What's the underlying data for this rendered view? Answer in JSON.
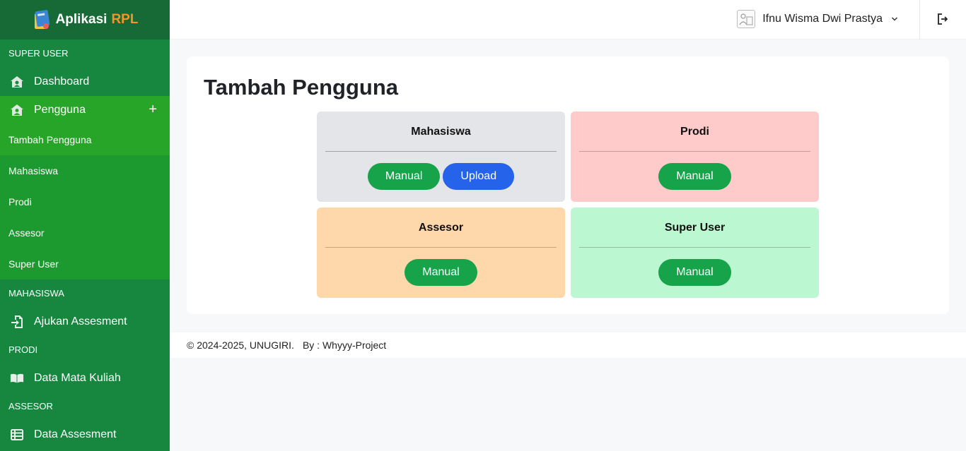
{
  "brand": {
    "name": "Aplikasi",
    "accent": "RPL",
    "accent_color": "#f59526"
  },
  "sidebar": {
    "sections": [
      {
        "title": "SUPER USER"
      },
      {
        "title": "MAHASISWA"
      },
      {
        "title": "PRODI"
      },
      {
        "title": "ASSESOR"
      }
    ],
    "items": {
      "dashboard": {
        "label": "Dashboard",
        "icon": "home-user-icon"
      },
      "pengguna": {
        "label": "Pengguna",
        "icon": "users-home-icon",
        "toggle": "+"
      },
      "ajukan": {
        "label": "Ajukan Assesment",
        "icon": "file-import-icon"
      },
      "matkul": {
        "label": "Data Mata Kuliah",
        "icon": "book-open-icon"
      },
      "assesment": {
        "label": "Data Assesment",
        "icon": "table-list-icon"
      }
    },
    "submenu": [
      "Tambah Pengguna",
      "Mahasiswa",
      "Prodi",
      "Assesor",
      "Super User"
    ]
  },
  "header": {
    "user_name": "Ifnu Wisma Dwi Prastya",
    "chevron": "⌄"
  },
  "main": {
    "title": "Tambah Pengguna",
    "boxes": [
      {
        "title": "Mahasiswa",
        "buttons": [
          "Manual",
          "Upload"
        ],
        "color": "#e4e5e9"
      },
      {
        "title": "Prodi",
        "buttons": [
          "Manual"
        ],
        "color": "#fecaca"
      },
      {
        "title": "Assesor",
        "buttons": [
          "Manual"
        ],
        "color": "#fed7aa"
      },
      {
        "title": "Super User",
        "buttons": [
          "Manual"
        ],
        "color": "#bbf7d0"
      }
    ]
  },
  "footer": {
    "copyright": "© 2024-2025, UNUGIRI.",
    "by": "By : Whyyy-Project"
  },
  "colors": {
    "sidebar": "#178740",
    "sidebar_active": "#27a528",
    "button_green": "#16a34a",
    "button_blue": "#2563eb"
  }
}
